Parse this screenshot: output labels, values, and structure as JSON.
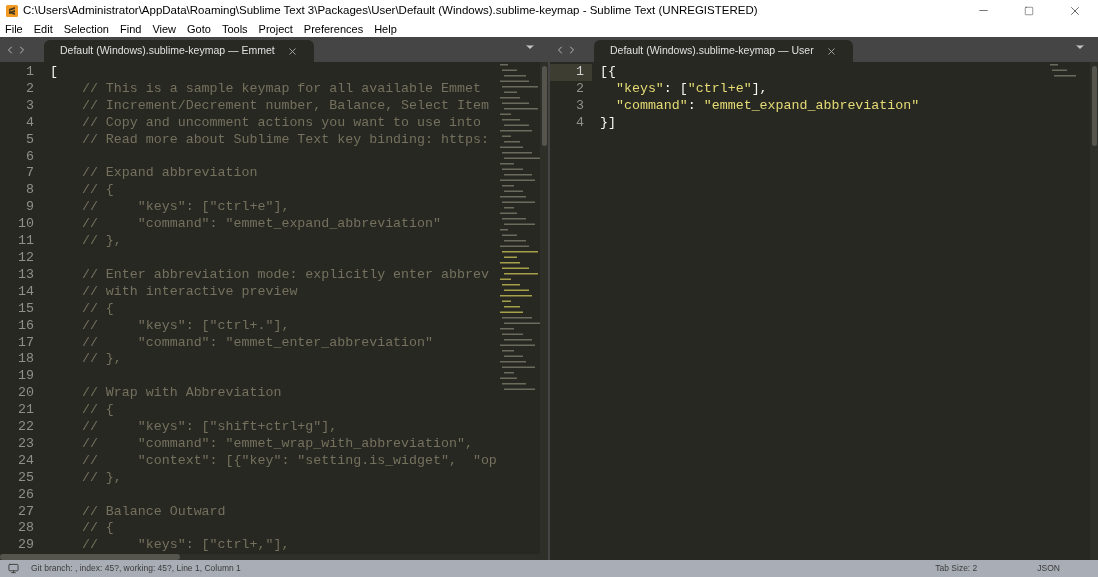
{
  "window": {
    "title": "C:\\Users\\Administrator\\AppData\\Roaming\\Sublime Text 3\\Packages\\User\\Default (Windows).sublime-keymap - Sublime Text (UNREGISTERED)"
  },
  "menu": [
    "File",
    "Edit",
    "Selection",
    "Find",
    "View",
    "Goto",
    "Tools",
    "Project",
    "Preferences",
    "Help"
  ],
  "panes": [
    {
      "tab": {
        "label": "Default (Windows).sublime-keymap — Emmet",
        "selected": true
      },
      "lines": [
        {
          "number": "1",
          "segments": [
            {
              "kind": "punct",
              "text": "["
            }
          ]
        },
        {
          "number": "2",
          "segments": [
            {
              "kind": "comment",
              "text": "    // This is a sample keymap for all available Emmet"
            }
          ]
        },
        {
          "number": "3",
          "segments": [
            {
              "kind": "comment",
              "text": "    // Increment/Decrement number, Balance, Select Item"
            }
          ]
        },
        {
          "number": "4",
          "segments": [
            {
              "kind": "comment",
              "text": "    // Copy and uncomment actions you want to use into"
            }
          ]
        },
        {
          "number": "5",
          "segments": [
            {
              "kind": "comment",
              "text": "    // Read more about Sublime Text key binding: https:"
            }
          ]
        },
        {
          "number": "6"
        },
        {
          "number": "7",
          "segments": [
            {
              "kind": "comment",
              "text": "    // Expand abbreviation"
            }
          ]
        },
        {
          "number": "8",
          "segments": [
            {
              "kind": "comment",
              "text": "    // {"
            }
          ]
        },
        {
          "number": "9",
          "segments": [
            {
              "kind": "comment",
              "text": "    //     \"keys\": [\"ctrl+e\"],"
            }
          ]
        },
        {
          "number": "10",
          "segments": [
            {
              "kind": "comment",
              "text": "    //     \"command\": \"emmet_expand_abbreviation\""
            }
          ]
        },
        {
          "number": "11",
          "segments": [
            {
              "kind": "comment",
              "text": "    // },"
            }
          ]
        },
        {
          "number": "12"
        },
        {
          "number": "13",
          "segments": [
            {
              "kind": "comment",
              "text": "    // Enter abbreviation mode: explicitly enter abbrev"
            }
          ]
        },
        {
          "number": "14",
          "segments": [
            {
              "kind": "comment",
              "text": "    // with interactive preview"
            }
          ]
        },
        {
          "number": "15",
          "segments": [
            {
              "kind": "comment",
              "text": "    // {"
            }
          ]
        },
        {
          "number": "16",
          "segments": [
            {
              "kind": "comment",
              "text": "    //     \"keys\": [\"ctrl+.\"],"
            }
          ]
        },
        {
          "number": "17",
          "segments": [
            {
              "kind": "comment",
              "text": "    //     \"command\": \"emmet_enter_abbreviation\""
            }
          ]
        },
        {
          "number": "18",
          "segments": [
            {
              "kind": "comment",
              "text": "    // },"
            }
          ]
        },
        {
          "number": "19"
        },
        {
          "number": "20",
          "segments": [
            {
              "kind": "comment",
              "text": "    // Wrap with Abbreviation"
            }
          ]
        },
        {
          "number": "21",
          "segments": [
            {
              "kind": "comment",
              "text": "    // {"
            }
          ]
        },
        {
          "number": "22",
          "segments": [
            {
              "kind": "comment",
              "text": "    //     \"keys\": [\"shift+ctrl+g\"],"
            }
          ]
        },
        {
          "number": "23",
          "segments": [
            {
              "kind": "comment",
              "text": "    //     \"command\": \"emmet_wrap_with_abbreviation\","
            }
          ]
        },
        {
          "number": "24",
          "segments": [
            {
              "kind": "comment",
              "text": "    //     \"context\": [{\"key\": \"setting.is_widget\",  \"op"
            }
          ]
        },
        {
          "number": "25",
          "segments": [
            {
              "kind": "comment",
              "text": "    // },"
            }
          ]
        },
        {
          "number": "26"
        },
        {
          "number": "27",
          "segments": [
            {
              "kind": "comment",
              "text": "    // Balance Outward"
            }
          ]
        },
        {
          "number": "28",
          "segments": [
            {
              "kind": "comment",
              "text": "    // {"
            }
          ]
        },
        {
          "number": "29",
          "segments": [
            {
              "kind": "comment",
              "text": "    //     \"keys\": [\"ctrl+,\"],"
            }
          ]
        }
      ]
    },
    {
      "tab": {
        "label": "Default (Windows).sublime-keymap — User",
        "selected": true
      },
      "lines": [
        {
          "number": "1",
          "current": true,
          "segments": [
            {
              "kind": "punct",
              "text": "[{"
            }
          ]
        },
        {
          "number": "2",
          "current": false,
          "segments": [
            {
              "kind": "string",
              "text": "  \"keys\""
            },
            {
              "kind": "punct",
              "text": ": ["
            },
            {
              "kind": "string",
              "text": "\"ctrl+e\""
            },
            {
              "kind": "punct",
              "text": "],"
            }
          ]
        },
        {
          "number": "3",
          "current": false,
          "segments": [
            {
              "kind": "string",
              "text": "  \"command\""
            },
            {
              "kind": "punct",
              "text": ": "
            },
            {
              "kind": "string",
              "text": "\"emmet_expand_abbreviation\""
            }
          ]
        },
        {
          "number": "4",
          "current": false,
          "segments": [
            {
              "kind": "punct",
              "text": "}]"
            }
          ]
        }
      ]
    }
  ],
  "status_bar": {
    "left": "Git branch: , index: 45?, working: 45?, Line 1, Column 1",
    "tab_size": "Tab Size: 2",
    "syntax": "JSON"
  }
}
